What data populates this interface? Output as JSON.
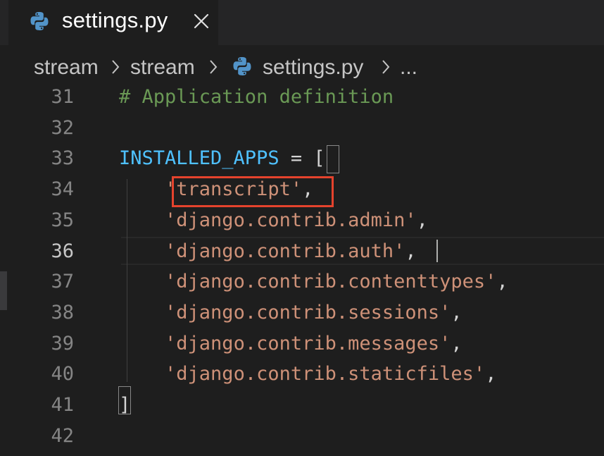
{
  "tab": {
    "label": "settings.py",
    "icon": "python-file-icon",
    "close_icon": "close-icon"
  },
  "breadcrumb": {
    "items": [
      "stream",
      "stream",
      "settings.py",
      "..."
    ]
  },
  "colors": {
    "comment": "#6a9955",
    "variable": "#4fc1ff",
    "string": "#ce9178",
    "highlight_box": "#e5432d"
  },
  "editor": {
    "active_line": "36",
    "lines": [
      {
        "num": "31",
        "tokens": [
          {
            "t": "# Application definition",
            "k": "comment"
          }
        ]
      },
      {
        "num": "32",
        "tokens": []
      },
      {
        "num": "33",
        "tokens": [
          {
            "t": "INSTALLED_APPS",
            "k": "var"
          },
          {
            "t": " = [",
            "k": "punct"
          }
        ]
      },
      {
        "num": "34",
        "tokens": [
          {
            "t": "    ",
            "k": "punct"
          },
          {
            "t": "'transcript'",
            "k": "str"
          },
          {
            "t": ",",
            "k": "punct"
          }
        ]
      },
      {
        "num": "35",
        "tokens": [
          {
            "t": "    ",
            "k": "punct"
          },
          {
            "t": "'django.contrib.admin'",
            "k": "str"
          },
          {
            "t": ",",
            "k": "punct"
          }
        ]
      },
      {
        "num": "36",
        "tokens": [
          {
            "t": "    ",
            "k": "punct"
          },
          {
            "t": "'django.contrib.auth'",
            "k": "str"
          },
          {
            "t": ",",
            "k": "punct"
          }
        ]
      },
      {
        "num": "37",
        "tokens": [
          {
            "t": "    ",
            "k": "punct"
          },
          {
            "t": "'django.contrib.contenttypes'",
            "k": "str"
          },
          {
            "t": ",",
            "k": "punct"
          }
        ]
      },
      {
        "num": "38",
        "tokens": [
          {
            "t": "    ",
            "k": "punct"
          },
          {
            "t": "'django.contrib.sessions'",
            "k": "str"
          },
          {
            "t": ",",
            "k": "punct"
          }
        ]
      },
      {
        "num": "39",
        "tokens": [
          {
            "t": "    ",
            "k": "punct"
          },
          {
            "t": "'django.contrib.messages'",
            "k": "str"
          },
          {
            "t": ",",
            "k": "punct"
          }
        ]
      },
      {
        "num": "40",
        "tokens": [
          {
            "t": "    ",
            "k": "punct"
          },
          {
            "t": "'django.contrib.staticfiles'",
            "k": "str"
          },
          {
            "t": ",",
            "k": "punct"
          }
        ]
      },
      {
        "num": "41",
        "tokens": [
          {
            "t": "]",
            "k": "punct"
          }
        ]
      },
      {
        "num": "42",
        "tokens": []
      }
    ]
  }
}
